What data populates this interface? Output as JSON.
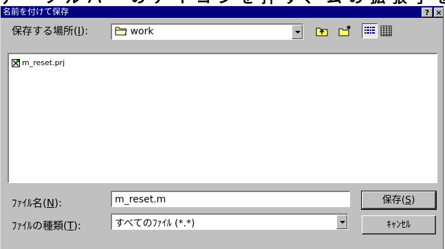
{
  "background_text": "ァ ・ ツ ル バ ー の ア イ コ ン を 押 す 、 ム の 拡 張 子 を つ け て 、 を 指 定 す る",
  "dialog": {
    "title": "名前を付けて保存",
    "help_label": "?",
    "close_label": "×"
  },
  "location": {
    "label_prefix": "保存する場所(",
    "label_key": "I",
    "label_suffix": "):",
    "value": "work",
    "icon": "folder-icon"
  },
  "toolbar": {
    "up_icon": "up-folder-icon",
    "new_folder_icon": "new-folder-icon",
    "list_view_icon": "list-view-icon",
    "details_view_icon": "details-view-icon"
  },
  "files": [
    {
      "name": "m_reset.prj",
      "icon": "project-file-icon"
    }
  ],
  "filename": {
    "label_prefix": "ﾌｧｲﾙ名(",
    "label_key": "N",
    "label_suffix": "):",
    "value": "m_reset.m"
  },
  "filetype": {
    "label_prefix": "ﾌｧｲﾙの種類(",
    "label_key": "T",
    "label_suffix": "):",
    "value": "すべてのﾌｧｲﾙ (*.*)"
  },
  "buttons": {
    "save_prefix": "保存(",
    "save_key": "S",
    "save_suffix": ")",
    "cancel_label": "ｷｬﾝｾﾙ"
  }
}
